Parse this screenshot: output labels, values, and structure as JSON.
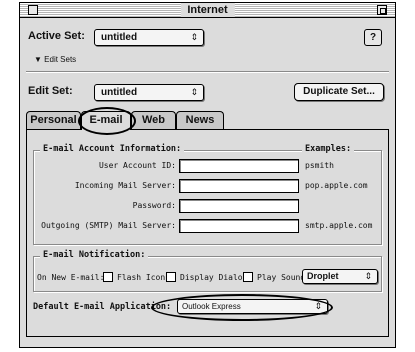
{
  "window": {
    "title": "Internet"
  },
  "top": {
    "active_set_label": "Active Set:",
    "active_set_value": "untitled",
    "edit_sets_label": "Edit Sets",
    "edit_set_label": "Edit Set:",
    "edit_set_value": "untitled",
    "duplicate_button": "Duplicate Set..."
  },
  "tabs": [
    "Personal",
    "E-mail",
    "Web",
    "News"
  ],
  "active_tab": "E-mail",
  "account_info": {
    "title": "E-mail Account Information:",
    "examples_title": "Examples:",
    "rows": [
      {
        "label": "User Account ID:",
        "value": "",
        "example": "psmith"
      },
      {
        "label": "Incoming Mail Server:",
        "value": "",
        "example": "pop.apple.com"
      },
      {
        "label": "Password:",
        "value": "",
        "example": ""
      },
      {
        "label": "Outgoing (SMTP) Mail Server:",
        "value": "",
        "example": "smtp.apple.com"
      }
    ]
  },
  "notification": {
    "title": "E-mail Notification:",
    "on_new_label": "On New E-mail:",
    "flash_icon": "Flash Icon",
    "display_dialog": "Display Dialog",
    "play_sound": "Play Sound:",
    "sound_value": "Droplet"
  },
  "default_app": {
    "label": "Default E-mail Application:",
    "value": "Outlook Express"
  }
}
